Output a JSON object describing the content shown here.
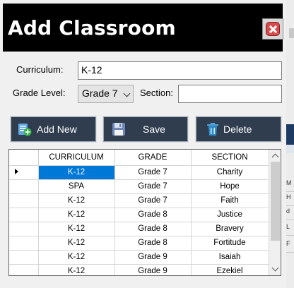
{
  "window": {
    "title": "Add Classroom"
  },
  "form": {
    "curriculum_label": "Curriculum:",
    "curriculum_value": "K-12",
    "grade_label": "Grade Level:",
    "grade_value": "Grade 7",
    "section_label": "Section:",
    "section_value": ""
  },
  "buttons": {
    "add_new": "Add New",
    "save": "Save",
    "delete": "Delete"
  },
  "table": {
    "columns": [
      "CURRICULUM",
      "GRADE",
      "SECTION"
    ],
    "rows": [
      [
        "K-12",
        "Grade 7",
        "Charity"
      ],
      [
        "SPA",
        "Grade 7",
        "Hope"
      ],
      [
        "K-12",
        "Grade 7",
        "Faith"
      ],
      [
        "K-12",
        "Grade 8",
        "Justice"
      ],
      [
        "K-12",
        "Grade 8",
        "Bravery"
      ],
      [
        "K-12",
        "Grade 8",
        "Fortitude"
      ],
      [
        "K-12",
        "Grade 9",
        "Isaiah"
      ],
      [
        "K-12",
        "Grade 9",
        "Ezekiel"
      ]
    ],
    "selected_row": 0
  },
  "side_strip": [
    "M",
    "H",
    "d",
    "L",
    "F"
  ],
  "icons": {
    "close": "close-icon",
    "add": "add-record-icon",
    "save": "floppy-disk-icon",
    "delete": "trash-icon"
  }
}
